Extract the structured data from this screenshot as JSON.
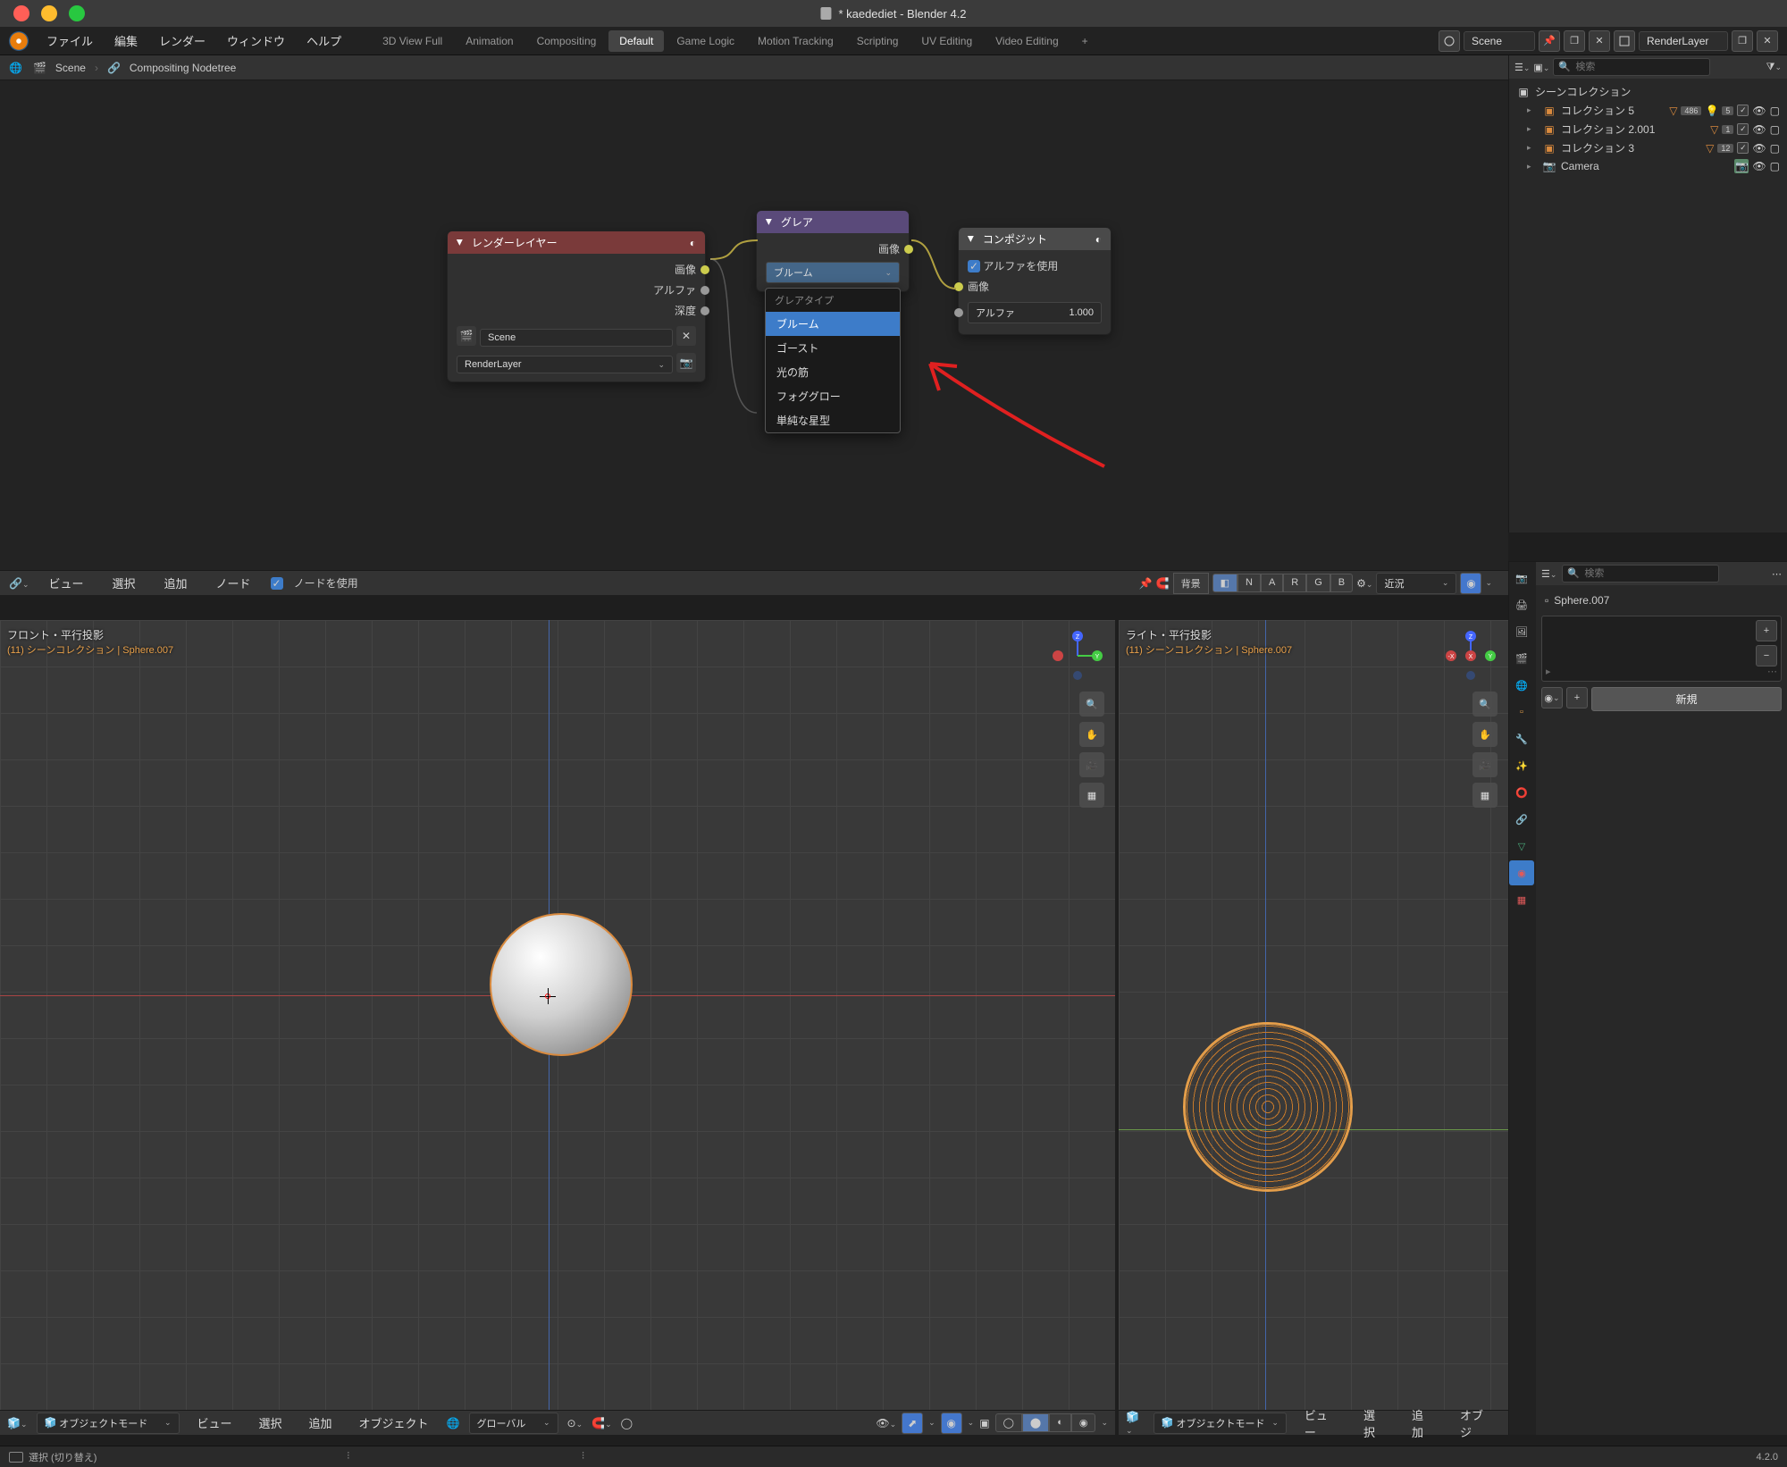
{
  "titlebar": {
    "title": "* kaedediet - Blender 4.2"
  },
  "menus": [
    "ファイル",
    "編集",
    "レンダー",
    "ウィンドウ",
    "ヘルプ"
  ],
  "workspaces": [
    "3D View Full",
    "Animation",
    "Compositing",
    "Default",
    "Game Logic",
    "Motion Tracking",
    "Scripting",
    "UV Editing",
    "Video Editing"
  ],
  "workspace_active": "Default",
  "header_right": {
    "scene_label": "Scene",
    "layer_label": "RenderLayer"
  },
  "node_editor": {
    "breadcrumb": [
      "Scene",
      "Compositing Nodetree"
    ],
    "footer": {
      "view": "ビュー",
      "select": "選択",
      "add": "追加",
      "node": "ノード",
      "use_nodes": "ノードを使用"
    },
    "header_right": {
      "bg": "背景",
      "letters": [
        "N",
        "A",
        "R",
        "G",
        "B"
      ],
      "proximity": "近況"
    }
  },
  "nodes": {
    "render_layers": {
      "title": "レンダーレイヤー",
      "out": {
        "image": "画像",
        "alpha": "アルファ",
        "depth": "深度"
      },
      "scene": "Scene",
      "layer": "RenderLayer"
    },
    "glare": {
      "title": "グレア",
      "out_image": "画像",
      "field_value": "ブルーム",
      "dropdown_header": "グレアタイプ",
      "options": [
        "ブルーム",
        "ゴースト",
        "光の筋",
        "フォググロー",
        "単純な星型"
      ]
    },
    "composite": {
      "title": "コンポジット",
      "use_alpha": "アルファを使用",
      "image": "画像",
      "alpha_label": "アルファ",
      "alpha_value": "1.000"
    }
  },
  "viewport_left": {
    "title": "フロント・平行投影",
    "sub_collection": "(11) シーンコレクション",
    "sub_object": "Sphere.007",
    "footer": {
      "mode": "オブジェクトモード",
      "view": "ビュー",
      "select": "選択",
      "add": "追加",
      "object": "オブジェクト",
      "global": "グローバル"
    }
  },
  "viewport_right": {
    "title": "ライト・平行投影",
    "sub_collection": "(11) シーンコレクション",
    "sub_object": "Sphere.007",
    "footer": {
      "mode": "オブジェクトモード",
      "view": "ビュー",
      "select": "選択",
      "add": "追加",
      "object": "オブジ"
    }
  },
  "outliner": {
    "search": "検索",
    "root": "シーンコレクション",
    "items": [
      {
        "label": "コレクション 5",
        "badge": "486",
        "extra": "5"
      },
      {
        "label": "コレクション 2.001",
        "badge": "1"
      },
      {
        "label": "コレクション 3",
        "badge": "12"
      },
      {
        "label": "Camera"
      }
    ]
  },
  "properties": {
    "search": "検索",
    "object": "Sphere.007",
    "new_btn": "新規"
  },
  "statusbar": {
    "hint": "選択 (切り替え)",
    "version": "4.2.0"
  }
}
